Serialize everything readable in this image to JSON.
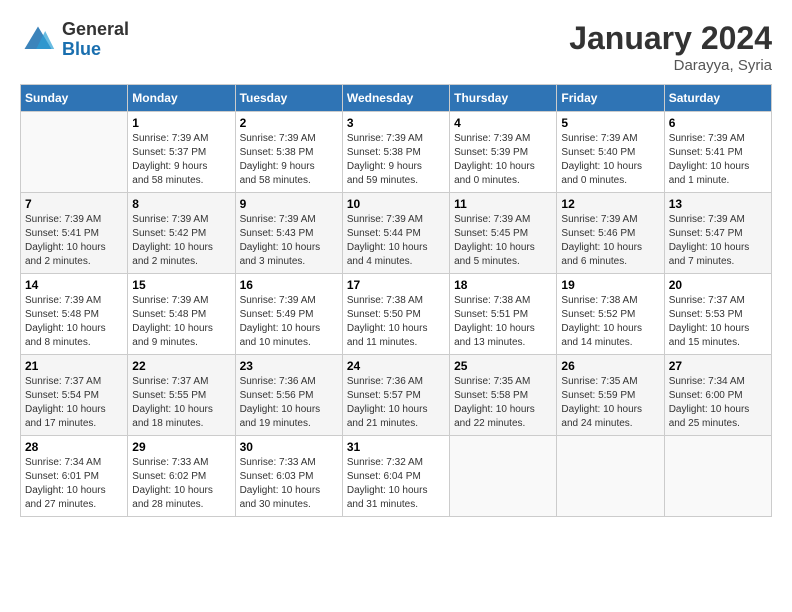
{
  "header": {
    "logo_general": "General",
    "logo_blue": "Blue",
    "month_title": "January 2024",
    "location": "Darayya, Syria"
  },
  "weekdays": [
    "Sunday",
    "Monday",
    "Tuesday",
    "Wednesday",
    "Thursday",
    "Friday",
    "Saturday"
  ],
  "weeks": [
    [
      {
        "day": "",
        "info": ""
      },
      {
        "day": "1",
        "info": "Sunrise: 7:39 AM\nSunset: 5:37 PM\nDaylight: 9 hours\nand 58 minutes."
      },
      {
        "day": "2",
        "info": "Sunrise: 7:39 AM\nSunset: 5:38 PM\nDaylight: 9 hours\nand 58 minutes."
      },
      {
        "day": "3",
        "info": "Sunrise: 7:39 AM\nSunset: 5:38 PM\nDaylight: 9 hours\nand 59 minutes."
      },
      {
        "day": "4",
        "info": "Sunrise: 7:39 AM\nSunset: 5:39 PM\nDaylight: 10 hours\nand 0 minutes."
      },
      {
        "day": "5",
        "info": "Sunrise: 7:39 AM\nSunset: 5:40 PM\nDaylight: 10 hours\nand 0 minutes."
      },
      {
        "day": "6",
        "info": "Sunrise: 7:39 AM\nSunset: 5:41 PM\nDaylight: 10 hours\nand 1 minute."
      }
    ],
    [
      {
        "day": "7",
        "info": "Sunrise: 7:39 AM\nSunset: 5:41 PM\nDaylight: 10 hours\nand 2 minutes."
      },
      {
        "day": "8",
        "info": "Sunrise: 7:39 AM\nSunset: 5:42 PM\nDaylight: 10 hours\nand 2 minutes."
      },
      {
        "day": "9",
        "info": "Sunrise: 7:39 AM\nSunset: 5:43 PM\nDaylight: 10 hours\nand 3 minutes."
      },
      {
        "day": "10",
        "info": "Sunrise: 7:39 AM\nSunset: 5:44 PM\nDaylight: 10 hours\nand 4 minutes."
      },
      {
        "day": "11",
        "info": "Sunrise: 7:39 AM\nSunset: 5:45 PM\nDaylight: 10 hours\nand 5 minutes."
      },
      {
        "day": "12",
        "info": "Sunrise: 7:39 AM\nSunset: 5:46 PM\nDaylight: 10 hours\nand 6 minutes."
      },
      {
        "day": "13",
        "info": "Sunrise: 7:39 AM\nSunset: 5:47 PM\nDaylight: 10 hours\nand 7 minutes."
      }
    ],
    [
      {
        "day": "14",
        "info": "Sunrise: 7:39 AM\nSunset: 5:48 PM\nDaylight: 10 hours\nand 8 minutes."
      },
      {
        "day": "15",
        "info": "Sunrise: 7:39 AM\nSunset: 5:48 PM\nDaylight: 10 hours\nand 9 minutes."
      },
      {
        "day": "16",
        "info": "Sunrise: 7:39 AM\nSunset: 5:49 PM\nDaylight: 10 hours\nand 10 minutes."
      },
      {
        "day": "17",
        "info": "Sunrise: 7:38 AM\nSunset: 5:50 PM\nDaylight: 10 hours\nand 11 minutes."
      },
      {
        "day": "18",
        "info": "Sunrise: 7:38 AM\nSunset: 5:51 PM\nDaylight: 10 hours\nand 13 minutes."
      },
      {
        "day": "19",
        "info": "Sunrise: 7:38 AM\nSunset: 5:52 PM\nDaylight: 10 hours\nand 14 minutes."
      },
      {
        "day": "20",
        "info": "Sunrise: 7:37 AM\nSunset: 5:53 PM\nDaylight: 10 hours\nand 15 minutes."
      }
    ],
    [
      {
        "day": "21",
        "info": "Sunrise: 7:37 AM\nSunset: 5:54 PM\nDaylight: 10 hours\nand 17 minutes."
      },
      {
        "day": "22",
        "info": "Sunrise: 7:37 AM\nSunset: 5:55 PM\nDaylight: 10 hours\nand 18 minutes."
      },
      {
        "day": "23",
        "info": "Sunrise: 7:36 AM\nSunset: 5:56 PM\nDaylight: 10 hours\nand 19 minutes."
      },
      {
        "day": "24",
        "info": "Sunrise: 7:36 AM\nSunset: 5:57 PM\nDaylight: 10 hours\nand 21 minutes."
      },
      {
        "day": "25",
        "info": "Sunrise: 7:35 AM\nSunset: 5:58 PM\nDaylight: 10 hours\nand 22 minutes."
      },
      {
        "day": "26",
        "info": "Sunrise: 7:35 AM\nSunset: 5:59 PM\nDaylight: 10 hours\nand 24 minutes."
      },
      {
        "day": "27",
        "info": "Sunrise: 7:34 AM\nSunset: 6:00 PM\nDaylight: 10 hours\nand 25 minutes."
      }
    ],
    [
      {
        "day": "28",
        "info": "Sunrise: 7:34 AM\nSunset: 6:01 PM\nDaylight: 10 hours\nand 27 minutes."
      },
      {
        "day": "29",
        "info": "Sunrise: 7:33 AM\nSunset: 6:02 PM\nDaylight: 10 hours\nand 28 minutes."
      },
      {
        "day": "30",
        "info": "Sunrise: 7:33 AM\nSunset: 6:03 PM\nDaylight: 10 hours\nand 30 minutes."
      },
      {
        "day": "31",
        "info": "Sunrise: 7:32 AM\nSunset: 6:04 PM\nDaylight: 10 hours\nand 31 minutes."
      },
      {
        "day": "",
        "info": ""
      },
      {
        "day": "",
        "info": ""
      },
      {
        "day": "",
        "info": ""
      }
    ]
  ]
}
